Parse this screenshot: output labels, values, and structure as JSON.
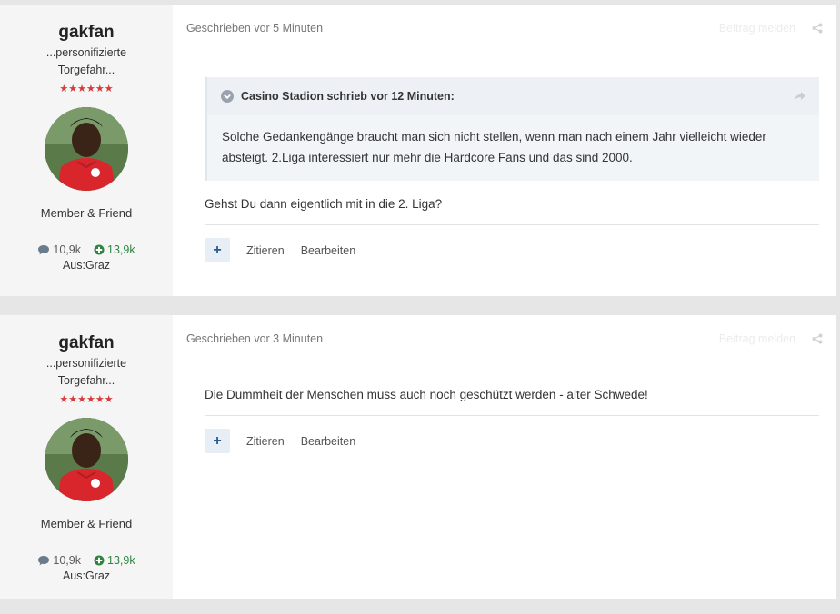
{
  "posts": [
    {
      "author": {
        "name": "gakfan",
        "title_line1": "...personifizierte",
        "title_line2": "Torgefahr...",
        "stars": "★★★★★★",
        "group": "Member & Friend",
        "posts_count": "10,9k",
        "reputation": "13,9k",
        "location": "Aus:Graz"
      },
      "date": "Geschrieben vor 5 Minuten",
      "report_label": "Beitrag melden",
      "quote": {
        "header": "Casino Stadion schrieb vor 12 Minuten:",
        "text": "Solche Gedankengänge braucht man sich nicht stellen, wenn man nach einem Jahr vielleicht wieder absteigt. 2.Liga interessiert nur mehr die Hardcore Fans und das sind 2000."
      },
      "text": "Gehst Du dann eigentlich mit in die 2. Liga?",
      "actions": {
        "plus": "+",
        "quote": "Zitieren",
        "edit": "Bearbeiten"
      }
    },
    {
      "author": {
        "name": "gakfan",
        "title_line1": "...personifizierte",
        "title_line2": "Torgefahr...",
        "stars": "★★★★★★",
        "group": "Member & Friend",
        "posts_count": "10,9k",
        "reputation": "13,9k",
        "location": "Aus:Graz"
      },
      "date": "Geschrieben vor 3 Minuten",
      "report_label": "Beitrag melden",
      "text": "Die Dummheit der Menschen muss auch noch geschützt werden - alter Schwede!",
      "actions": {
        "plus": "+",
        "quote": "Zitieren",
        "edit": "Bearbeiten"
      }
    }
  ],
  "colors": {
    "reputation_green": "#2e8540",
    "stars_red": "#d43c3c",
    "quote_bg": "#f2f5f8"
  }
}
